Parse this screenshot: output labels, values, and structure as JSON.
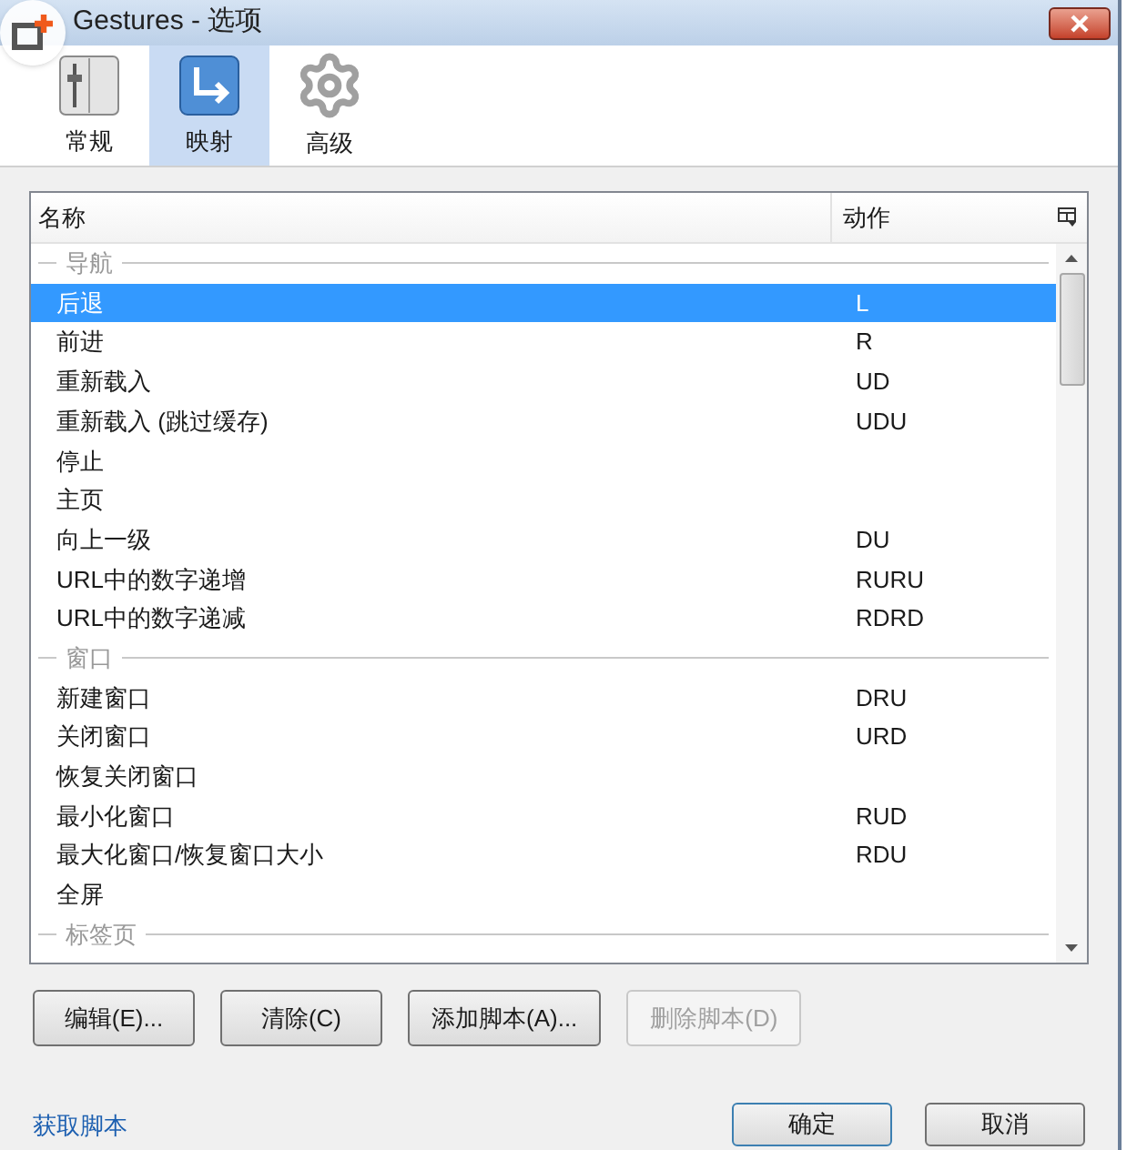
{
  "window": {
    "title": "Gestures - 选项"
  },
  "tabs": [
    {
      "label": "常规",
      "selected": false,
      "kind": "general"
    },
    {
      "label": "映射",
      "selected": true,
      "kind": "mapping"
    },
    {
      "label": "高级",
      "selected": false,
      "kind": "advanced"
    }
  ],
  "table": {
    "columns": [
      "名称",
      "动作"
    ],
    "rows": [
      {
        "kind": "group",
        "name": "导航"
      },
      {
        "kind": "action",
        "name": "后退",
        "gesture": "L",
        "selected": true
      },
      {
        "kind": "action",
        "name": "前进",
        "gesture": "R",
        "selected": false
      },
      {
        "kind": "action",
        "name": "重新载入",
        "gesture": "UD",
        "selected": false
      },
      {
        "kind": "action",
        "name": "重新载入 (跳过缓存)",
        "gesture": "UDU",
        "selected": false
      },
      {
        "kind": "action",
        "name": "停止",
        "selected": false
      },
      {
        "kind": "action",
        "name": "主页",
        "selected": false
      },
      {
        "kind": "action",
        "name": "向上一级",
        "gesture": "DU",
        "selected": false
      },
      {
        "kind": "action",
        "name": "URL中的数字递增",
        "gesture": "RURU",
        "selected": false
      },
      {
        "kind": "action",
        "name": "URL中的数字递减",
        "gesture": "RDRD",
        "selected": false
      },
      {
        "kind": "group",
        "name": "窗口"
      },
      {
        "kind": "action",
        "name": "新建窗口",
        "gesture": "DRU",
        "selected": false
      },
      {
        "kind": "action",
        "name": "关闭窗口",
        "gesture": "URD",
        "selected": false
      },
      {
        "kind": "action",
        "name": "恢复关闭窗口",
        "selected": false
      },
      {
        "kind": "action",
        "name": "最小化窗口",
        "gesture": "RUD",
        "selected": false
      },
      {
        "kind": "action",
        "name": "最大化窗口/恢复窗口大小",
        "gesture": "RDU",
        "selected": false
      },
      {
        "kind": "action",
        "name": "全屏",
        "selected": false
      },
      {
        "kind": "group",
        "name": "标签页"
      }
    ]
  },
  "buttons": [
    {
      "label": "编辑(E)...",
      "disabled": false
    },
    {
      "label": "清除(C)",
      "disabled": false
    },
    {
      "label": "添加脚本(A)...",
      "disabled": false
    },
    {
      "label": "删除脚本(D)",
      "disabled": true
    }
  ],
  "footer": {
    "link": "获取脚本",
    "buttons": [
      "确定",
      "取消"
    ]
  }
}
